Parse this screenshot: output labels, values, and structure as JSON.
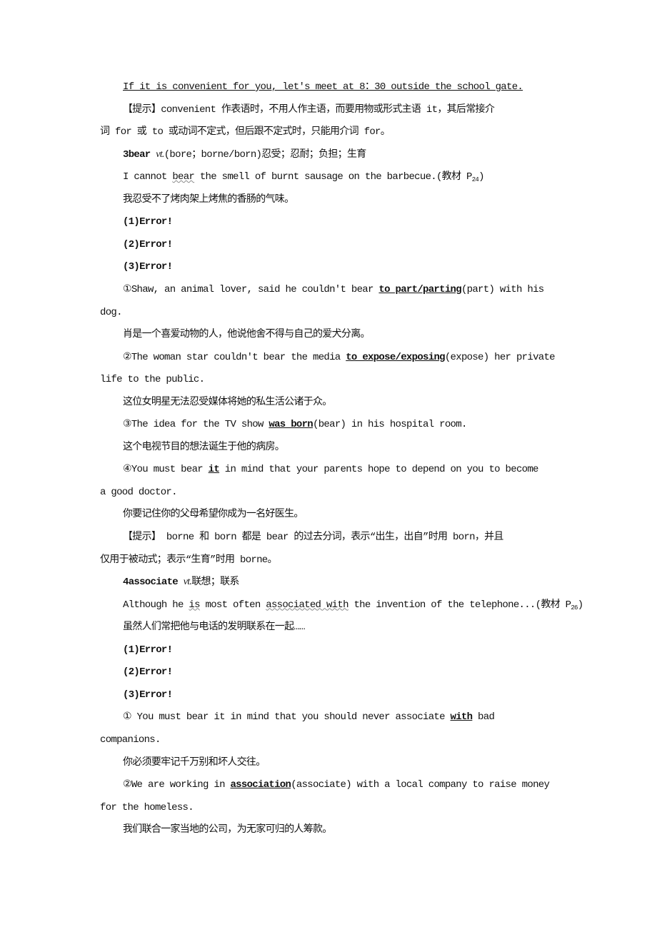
{
  "paragraphs": [
    {
      "lines": [
        [
          {
            "text": "If it is convenient for you, let's meet at 8：30 outside the school gate.",
            "style": "u"
          }
        ]
      ]
    },
    {
      "lines": [
        [
          "【提示】convenient 作表语时，不用人作主语，而要用物或形式主语 it，其后常接介"
        ],
        [
          "词 for 或 to 或动词不定式，但后跟不定式时，只能用介词 for。"
        ]
      ]
    },
    {
      "lines": [
        [
          {
            "text": "3bear",
            "style": "b"
          },
          "  ",
          {
            "text": "vt.",
            "style": "i"
          },
          "(bore；borne/born)忍受；忍耐；负担；生育"
        ]
      ]
    },
    {
      "lines": [
        [
          "I cannot ",
          {
            "text": "bear",
            "style": "w"
          },
          " the smell of burnt sausage on the barbecue.(教材 P",
          {
            "text": "24",
            "style": "sub"
          },
          ")"
        ]
      ]
    },
    {
      "lines": [
        [
          "我忍受不了烤肉架上烤焦的香肠的气味。"
        ]
      ]
    },
    {
      "lines": [
        [
          {
            "text": "(1)Error!",
            "style": "b"
          }
        ]
      ]
    },
    {
      "lines": [
        [
          {
            "text": "(2)Error!",
            "style": "b"
          }
        ]
      ]
    },
    {
      "lines": [
        [
          {
            "text": "(3)Error!",
            "style": "b"
          }
        ]
      ]
    },
    {
      "lines": [
        [
          "①Shaw, an animal lover, said he couldn't bear ",
          {
            "text": "to part/parting",
            "style": "ub"
          },
          "(part) with his"
        ],
        [
          "dog."
        ]
      ]
    },
    {
      "lines": [
        [
          "肖是一个喜爱动物的人，他说他舍不得与自己的爱犬分离。"
        ]
      ]
    },
    {
      "lines": [
        [
          "②The woman star couldn't bear the media ",
          {
            "text": "to expose/exposing",
            "style": "ub"
          },
          "(expose) her private"
        ],
        [
          "life to the public."
        ]
      ]
    },
    {
      "lines": [
        [
          "这位女明星无法忍受媒体将她的私生活公诸于众。"
        ]
      ]
    },
    {
      "lines": [
        [
          "③The idea for the TV show ",
          {
            "text": "was born",
            "style": "ub"
          },
          "(bear) in his hospital room."
        ]
      ]
    },
    {
      "lines": [
        [
          "这个电视节目的想法诞生于他的病房。"
        ]
      ]
    },
    {
      "lines": [
        [
          "④You must bear ",
          {
            "text": "it",
            "style": "ub"
          },
          " in mind that your parents hope to depend on you to become"
        ],
        [
          "a good doctor."
        ]
      ]
    },
    {
      "lines": [
        [
          "你要记住你的父母希望你成为一名好医生。"
        ]
      ]
    },
    {
      "lines": [
        [
          "【提示】 borne 和 born 都是 bear 的过去分词，表示“出生，出自”时用 born，并且"
        ],
        [
          "仅用于被动式；表示“生育”时用 borne。"
        ]
      ]
    },
    {
      "lines": [
        [
          {
            "text": "4associate",
            "style": "b"
          },
          "  ",
          {
            "text": "vt.",
            "style": "i"
          },
          "联想；联系"
        ]
      ]
    },
    {
      "lines": [
        [
          "Although he ",
          {
            "text": "is",
            "style": "w"
          },
          " most often ",
          {
            "text": "associated with",
            "style": "w"
          },
          " the invention of the telephone...(教材 P",
          {
            "text": "26",
            "style": "sub"
          },
          ")"
        ]
      ]
    },
    {
      "lines": [
        [
          "虽然人们常把他与电话的发明联系在一起……"
        ]
      ]
    },
    {
      "lines": [
        [
          {
            "text": "(1)Error!",
            "style": "b"
          }
        ]
      ]
    },
    {
      "lines": [
        [
          {
            "text": "(2)Error!",
            "style": "b"
          }
        ]
      ]
    },
    {
      "lines": [
        [
          {
            "text": "(3)Error!",
            "style": "b"
          }
        ]
      ]
    },
    {
      "lines": [
        [
          "① You  must  bear  it  in  mind  that  you  should  never  associate  ",
          {
            "text": "with",
            "style": "ub"
          },
          "  bad"
        ],
        [
          "companions."
        ]
      ]
    },
    {
      "lines": [
        [
          "你必须要牢记千万别和坏人交往。"
        ]
      ]
    },
    {
      "lines": [
        [
          "②We are working in ",
          {
            "text": "association",
            "style": "ub"
          },
          "(associate) with a local company to raise money"
        ],
        [
          "for the homeless."
        ]
      ]
    },
    {
      "lines": [
        [
          "我们联合一家当地的公司，为无家可归的人筹款。"
        ]
      ]
    }
  ]
}
